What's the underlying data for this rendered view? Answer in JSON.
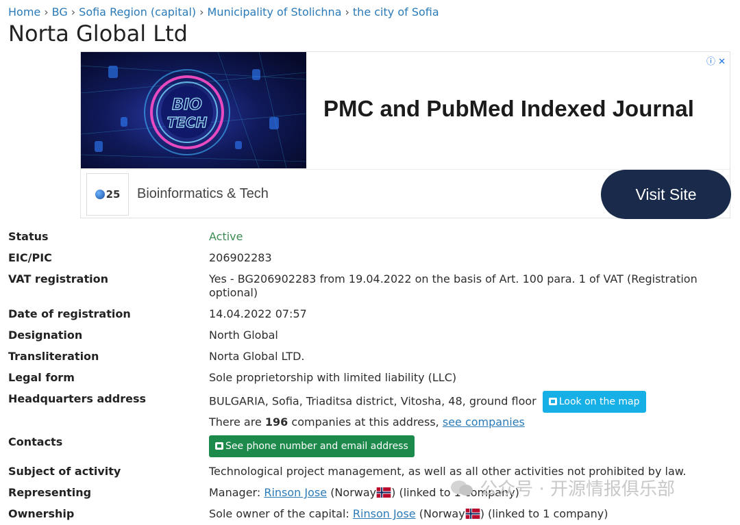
{
  "breadcrumb": [
    {
      "label": "Home"
    },
    {
      "label": "BG"
    },
    {
      "label": "Sofia Region (capital)"
    },
    {
      "label": "Municipality of Stolichna"
    },
    {
      "label": "the city of Sofia"
    }
  ],
  "breadcrumb_separator": "›",
  "page_title": "Norta Global Ltd",
  "ad": {
    "image_text": "BIO TECH",
    "headline": "PMC and PubMed Indexed Journal",
    "brand": "Bioinformatics & Tech",
    "logo_number": "25",
    "cta": "Visit Site",
    "controls": "ⓘ ✕"
  },
  "company": {
    "status_label": "Status",
    "status_value": "Active",
    "eic_label": "EIC/PIC",
    "eic_value": "206902283",
    "vat_label": "VAT registration",
    "vat_value": "Yes - BG206902283 from 19.04.2022 on the basis of Art. 100 para. 1 of VAT (Registration optional)",
    "date_label": "Date of registration",
    "date_value": "14.04.2022 07:57",
    "designation_label": "Designation",
    "designation_value": "North Global",
    "translit_label": "Transliteration",
    "translit_value": "Norta Global LTD.",
    "legal_label": "Legal form",
    "legal_value": "Sole proprietorship with limited liability (LLC)",
    "hq_label": "Headquarters address",
    "hq_value": "BULGARIA, Sofia, Triaditsa district, Vitosha, 48, ground floor",
    "map_button": "Look on the map",
    "companies_prefix": "There are",
    "companies_count": "196",
    "companies_suffix": "companies at this address,",
    "see_companies": "see companies",
    "contacts_label": "Contacts",
    "contacts_button": "See phone number and email address",
    "subject_label": "Subject of activity",
    "subject_value": "Technological project management, as well as all other activities not prohibited by law.",
    "representing_label": "Representing",
    "representing_role": "Manager:",
    "representing_person": "Rinson Jose",
    "representing_country": "(Norway",
    "representing_suffix": ") (linked to 1 company)",
    "ownership_label": "Ownership",
    "ownership_role": "Sole owner of the capital:",
    "ownership_person": "Rinson Jose",
    "ownership_country": "(Norway",
    "ownership_suffix": ") (linked to 1 company)"
  },
  "watermark": "公众号 · 开源情报俱乐部",
  "colors": {
    "link": "#2a7ab8",
    "active": "#3c8a52",
    "map_button": "#17b0e6",
    "contact_button": "#1c8a4a",
    "cta": "#1a2a4a"
  }
}
